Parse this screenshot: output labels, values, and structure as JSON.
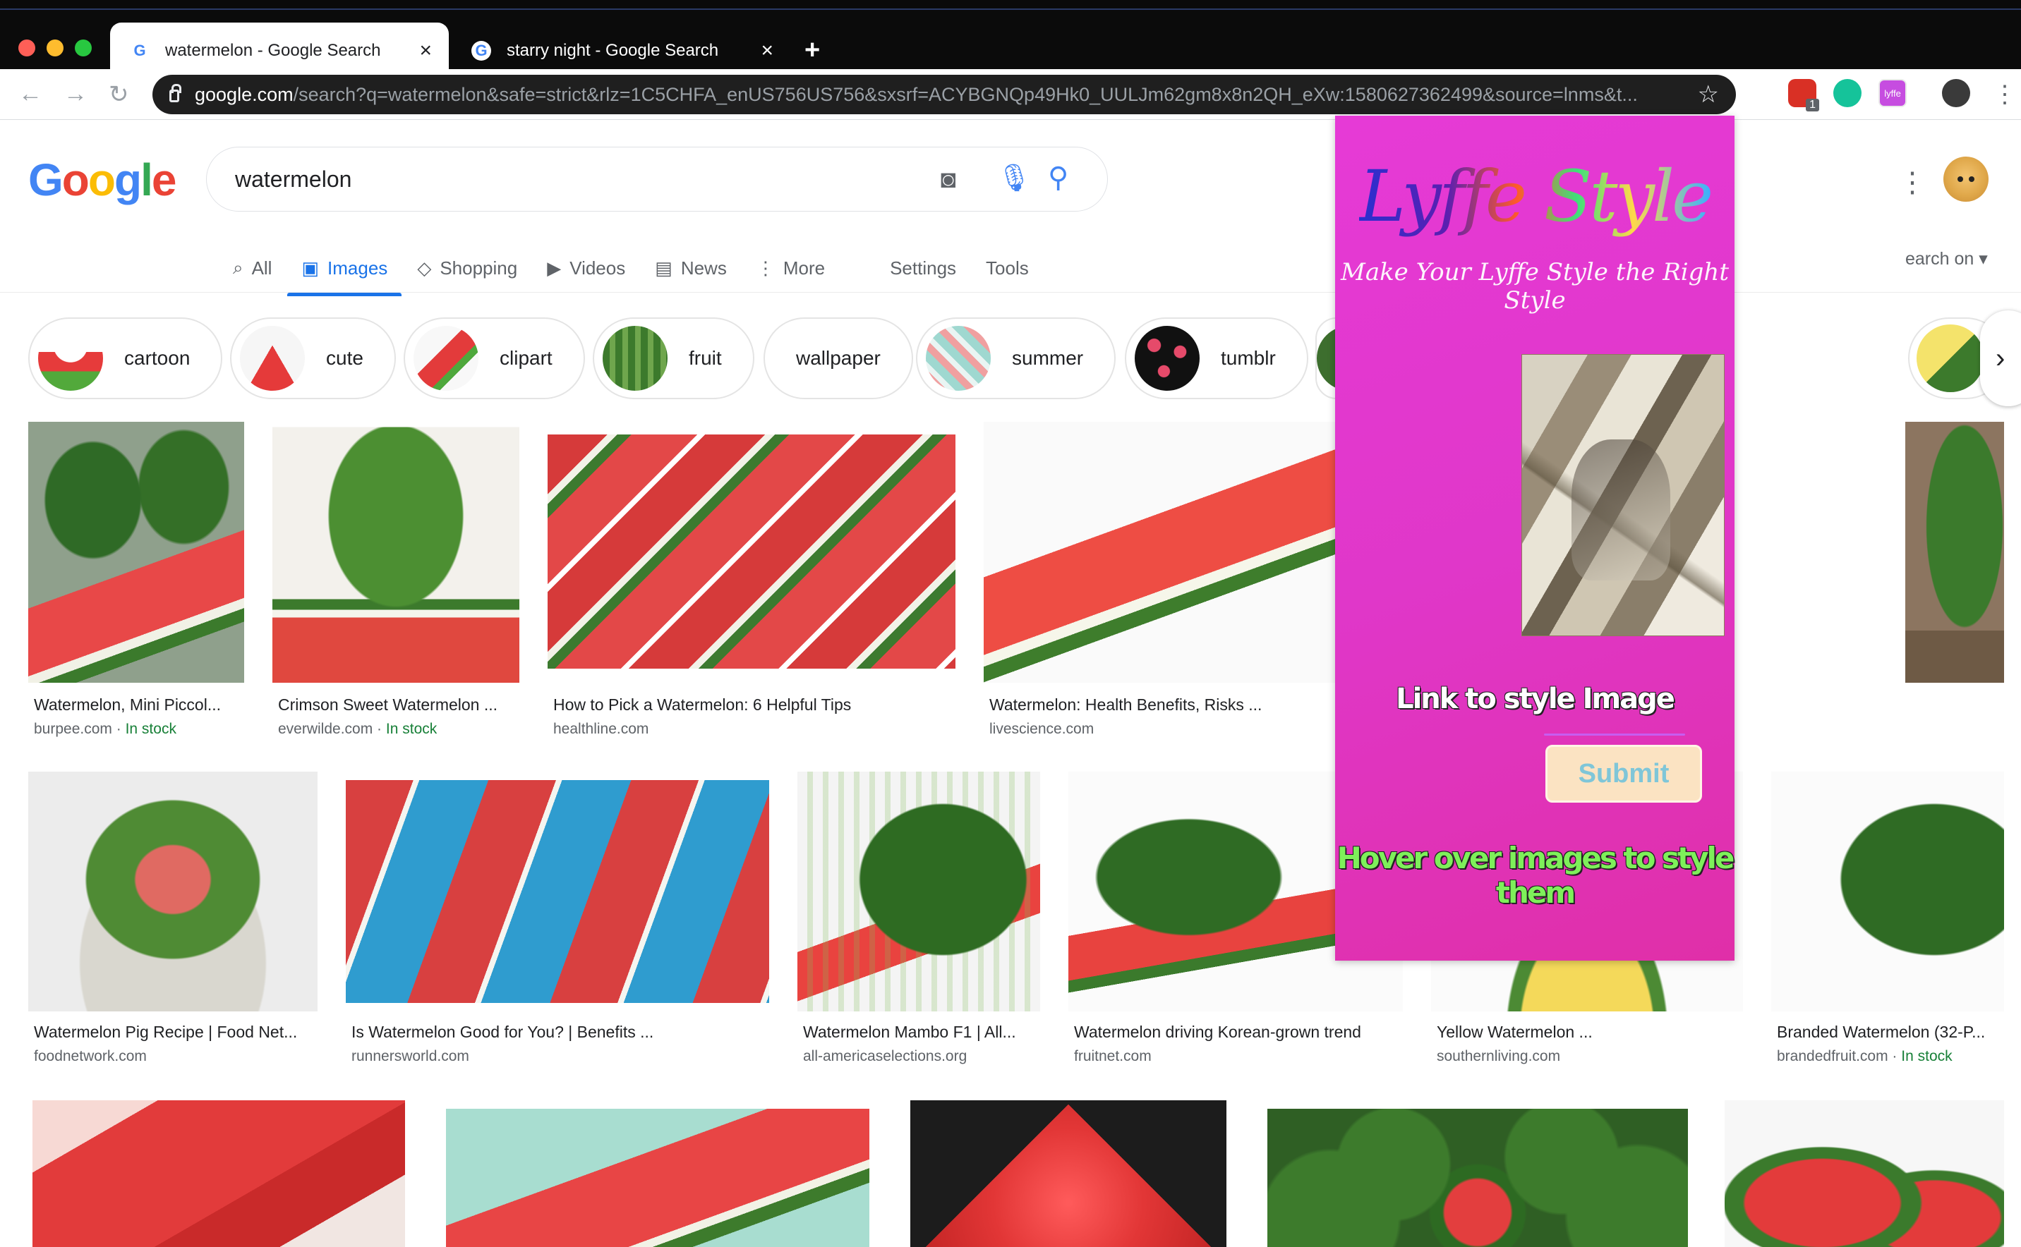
{
  "browser": {
    "tabs": [
      {
        "title": "watermelon - Google Search",
        "close": "×"
      },
      {
        "title": "starry night - Google Search",
        "close": "×"
      }
    ],
    "new_tab": "+",
    "url_host": "google.com",
    "url_path": "/search?q=watermelon&safe=strict&rlz=1C5CHFA_enUS756US756&sxsrf=ACYBGNQp49Hk0_UULJm62gm8x8n2QH_eXw:1580627362499&source=lnms&t...",
    "bookmark_star": "☆",
    "extension_badge": "1",
    "lyffe_icon_text": "lyffe",
    "menu": "⋮"
  },
  "google": {
    "logo": [
      "G",
      "o",
      "o",
      "g",
      "l",
      "e"
    ],
    "logo_colors": [
      "#4285f4",
      "#ea4335",
      "#fbbc05",
      "#4285f4",
      "#34a853",
      "#ea4335"
    ],
    "query": "watermelon",
    "nav": [
      {
        "icon": "⌕",
        "label": "All"
      },
      {
        "icon": "▣",
        "label": "Images"
      },
      {
        "icon": "◇",
        "label": "Shopping"
      },
      {
        "icon": "▶",
        "label": "Videos"
      },
      {
        "icon": "▤",
        "label": "News"
      },
      {
        "icon": "⋮",
        "label": "More"
      },
      {
        "icon": "",
        "label": "Settings"
      },
      {
        "icon": "",
        "label": "Tools"
      }
    ],
    "safesearch_partial": "earch on ▾"
  },
  "chips": [
    "cartoon",
    "cute",
    "clipart",
    "fruit",
    "wallpaper",
    "summer",
    "tumblr"
  ],
  "results": [
    {
      "title": "Watermelon, Mini Piccol...",
      "source": "burpee.com",
      "stock": "In stock"
    },
    {
      "title": "Crimson Sweet Watermelon ...",
      "source": "everwilde.com",
      "stock": "In stock"
    },
    {
      "title": "How to Pick a Watermelon: 6 Helpful Tips",
      "source": "healthline.com",
      "stock": ""
    },
    {
      "title": "Watermelon: Health Benefits, Risks ...",
      "source": "livescience.com",
      "stock": ""
    },
    {
      "title": "Watermelon Pig Recipe | Food Net...",
      "source": "foodnetwork.com",
      "stock": ""
    },
    {
      "title": "Is Watermelon Good for You? | Benefits ...",
      "source": "runnersworld.com",
      "stock": ""
    },
    {
      "title": "Watermelon Mambo F1 | All...",
      "source": "all-americaselections.org",
      "stock": ""
    },
    {
      "title": "Watermelon driving Korean-grown trend",
      "source": "fruitnet.com",
      "stock": ""
    },
    {
      "title": "Yellow Watermelon ...",
      "source": "southernliving.com",
      "stock": ""
    },
    {
      "title": "Branded Watermelon (32-P...",
      "source": "brandedfruit.com",
      "stock": "In stock"
    }
  ],
  "popup": {
    "logo_text": "Lyffe Style",
    "tagline": "Make Your Lyffe Style the Right Style",
    "link_label": "Link to style Image",
    "submit": "Submit",
    "hover_label": "Hover over images to style them",
    "background": "#e037c9"
  }
}
